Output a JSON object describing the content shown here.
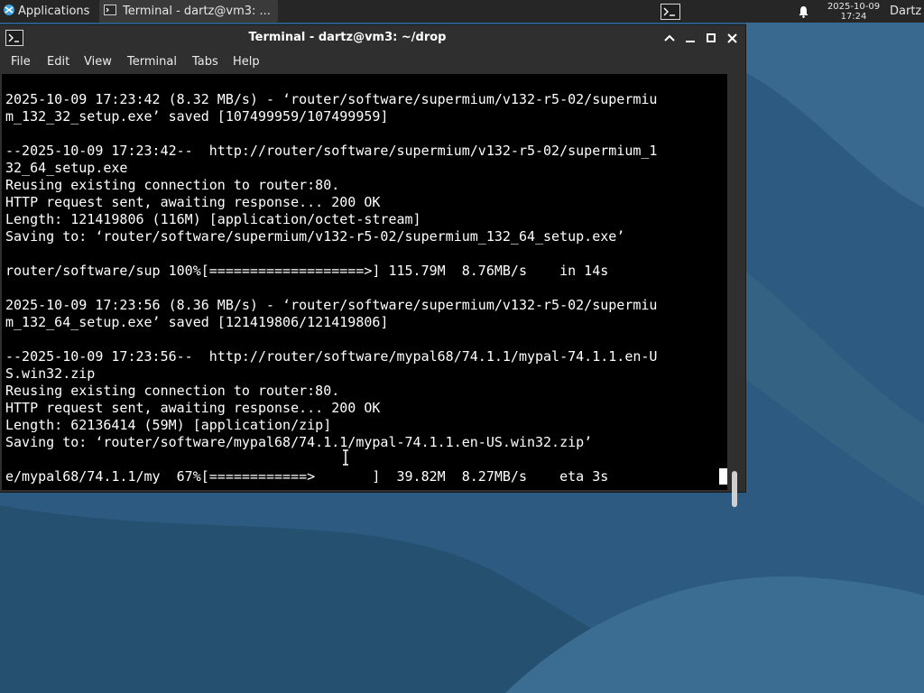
{
  "panel": {
    "applications_label": "Applications",
    "task_terminal_label": "Terminal - dartz@vm3: ...",
    "clock_date": "2025-10-09",
    "clock_time": "17:24",
    "user_label": "Dartz",
    "icons": [
      "xfce-logo-icon",
      "terminal-icon",
      "terminal-launcher-icon",
      "bell-icon"
    ]
  },
  "window": {
    "title": "Terminal - dartz@vm3: ~/drop",
    "menus": [
      "File",
      "Edit",
      "View",
      "Terminal",
      "Tabs",
      "Help"
    ],
    "controls": [
      "chevron-up-icon",
      "minimize-icon",
      "maximize-icon",
      "close-icon"
    ]
  },
  "terminal": {
    "lines": [
      "2025-10-09 17:23:42 (8.32 MB/s) - ‘router/software/supermium/v132-r5-02/supermiu",
      "m_132_32_setup.exe’ saved [107499959/107499959]",
      "",
      "--2025-10-09 17:23:42--  http://router/software/supermium/v132-r5-02/supermium_1",
      "32_64_setup.exe",
      "Reusing existing connection to router:80.",
      "HTTP request sent, awaiting response... 200 OK",
      "Length: 121419806 (116M) [application/octet-stream]",
      "Saving to: ‘router/software/supermium/v132-r5-02/supermium_132_64_setup.exe’",
      "",
      "router/software/sup 100%[===================>] 115.79M  8.76MB/s    in 14s",
      "",
      "2025-10-09 17:23:56 (8.36 MB/s) - ‘router/software/supermium/v132-r5-02/supermiu",
      "m_132_64_setup.exe’ saved [121419806/121419806]",
      "",
      "--2025-10-09 17:23:56--  http://router/software/mypal68/74.1.1/mypal-74.1.1.en-U",
      "S.win32.zip",
      "Reusing existing connection to router:80.",
      "HTTP request sent, awaiting response... 200 OK",
      "Length: 62136414 (59M) [application/zip]",
      "Saving to: ‘router/software/mypal68/74.1.1/mypal-74.1.1.en-US.win32.zip’",
      "",
      "e/mypal68/74.1.1/my  67%[============>       ]  39.82M  8.27MB/s    eta 3s"
    ]
  },
  "colors": {
    "panel_bg": "#262626",
    "window_bg": "#2f2f2f",
    "terminal_bg": "#000000",
    "terminal_fg": "#ffffff",
    "desktop_bg": "#2c5a80"
  }
}
